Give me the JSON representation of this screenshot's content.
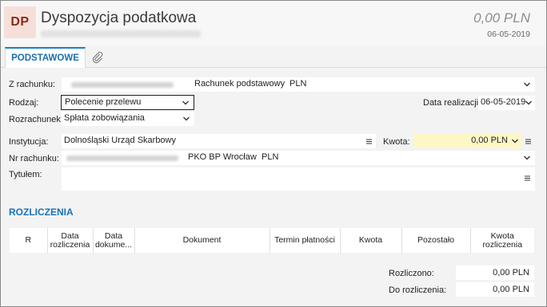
{
  "header": {
    "badge": "DP",
    "title": "Dyspozycja podatkowa",
    "amount": "0,00 PLN",
    "date": "06-05-2019"
  },
  "tabs": {
    "main": "PODSTAWOWE",
    "attach_icon": "paperclip-icon"
  },
  "form": {
    "z_rachunku_label": "Z rachunku:",
    "z_rachunku_account_type": "Rachunek podstawowy",
    "z_rachunku_currency": "PLN",
    "rodzaj_label": "Rodzaj:",
    "rodzaj_value": "Polecenie przelewu",
    "data_realizacji_label": "Data realizacji:",
    "data_realizacji_value": "06-05-2019",
    "rozrachunek_label": "Rozrachunek:",
    "rozrachunek_value": "Spłata zobowiązania",
    "instytucja_label": "Instytucja:",
    "instytucja_value": "Dolnośląski Urząd Skarbowy",
    "kwota_label": "Kwota:",
    "kwota_value": "0,00 PLN",
    "nr_rachunku_label": "Nr rachunku:",
    "nr_rachunku_bank": "PKO BP Wrocław",
    "nr_rachunku_currency": "PLN",
    "tytulem_label": "Tytułem:"
  },
  "rozliczenia": {
    "title": "ROZLICZENIA",
    "columns": [
      [
        "R"
      ],
      [
        "Data",
        "rozliczenia"
      ],
      [
        "Data",
        "dokume..."
      ],
      [
        "Dokument"
      ],
      [
        "Termin płatności"
      ],
      [
        "Kwota"
      ],
      [
        "Pozostało"
      ],
      [
        "Kwota",
        "rozliczenia"
      ]
    ]
  },
  "summary": {
    "rozliczono_label": "Rozliczono:",
    "rozliczono_value": "0,00 PLN",
    "do_rozliczenia_label": "Do rozliczenia:",
    "do_rozliczenia_value": "0,00 PLN"
  },
  "colors": {
    "accent": "#1a72b8",
    "badge_bg": "#f6dfd9",
    "badge_fg": "#8b2a1a",
    "amount_highlight": "#fdf7c6"
  }
}
